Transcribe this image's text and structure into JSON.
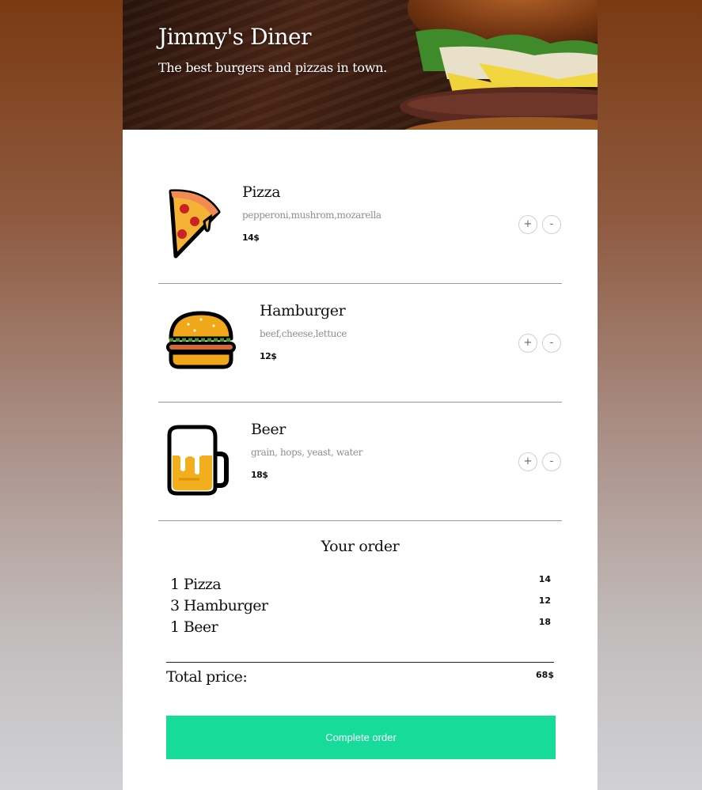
{
  "header": {
    "title": "Jimmy's Diner",
    "subtitle": "The best burgers and pizzas in town."
  },
  "menu": [
    {
      "icon": "pizza-icon",
      "name": "Pizza",
      "ingredients": "pepperoni,mushrom,mozarella",
      "price": "14$",
      "add_label": "+",
      "remove_label": "-"
    },
    {
      "icon": "hamburger-icon",
      "name": "Hamburger",
      "ingredients": "beef,cheese,lettuce",
      "price": "12$",
      "add_label": "+",
      "remove_label": "-"
    },
    {
      "icon": "beer-icon",
      "name": "Beer",
      "ingredients": "grain, hops, yeast, water",
      "price": "18$",
      "add_label": "+",
      "remove_label": "-"
    }
  ],
  "order": {
    "title": "Your order",
    "lines": [
      {
        "label": "1 Pizza",
        "amount": "14"
      },
      {
        "label": "3 Hamburger",
        "amount": "12"
      },
      {
        "label": "1 Beer",
        "amount": "18"
      }
    ],
    "total_label": "Total price:",
    "total_value": "68$",
    "complete_label": "Complete order"
  },
  "colors": {
    "accent": "#16db99",
    "divider": "#9a9a9a"
  }
}
